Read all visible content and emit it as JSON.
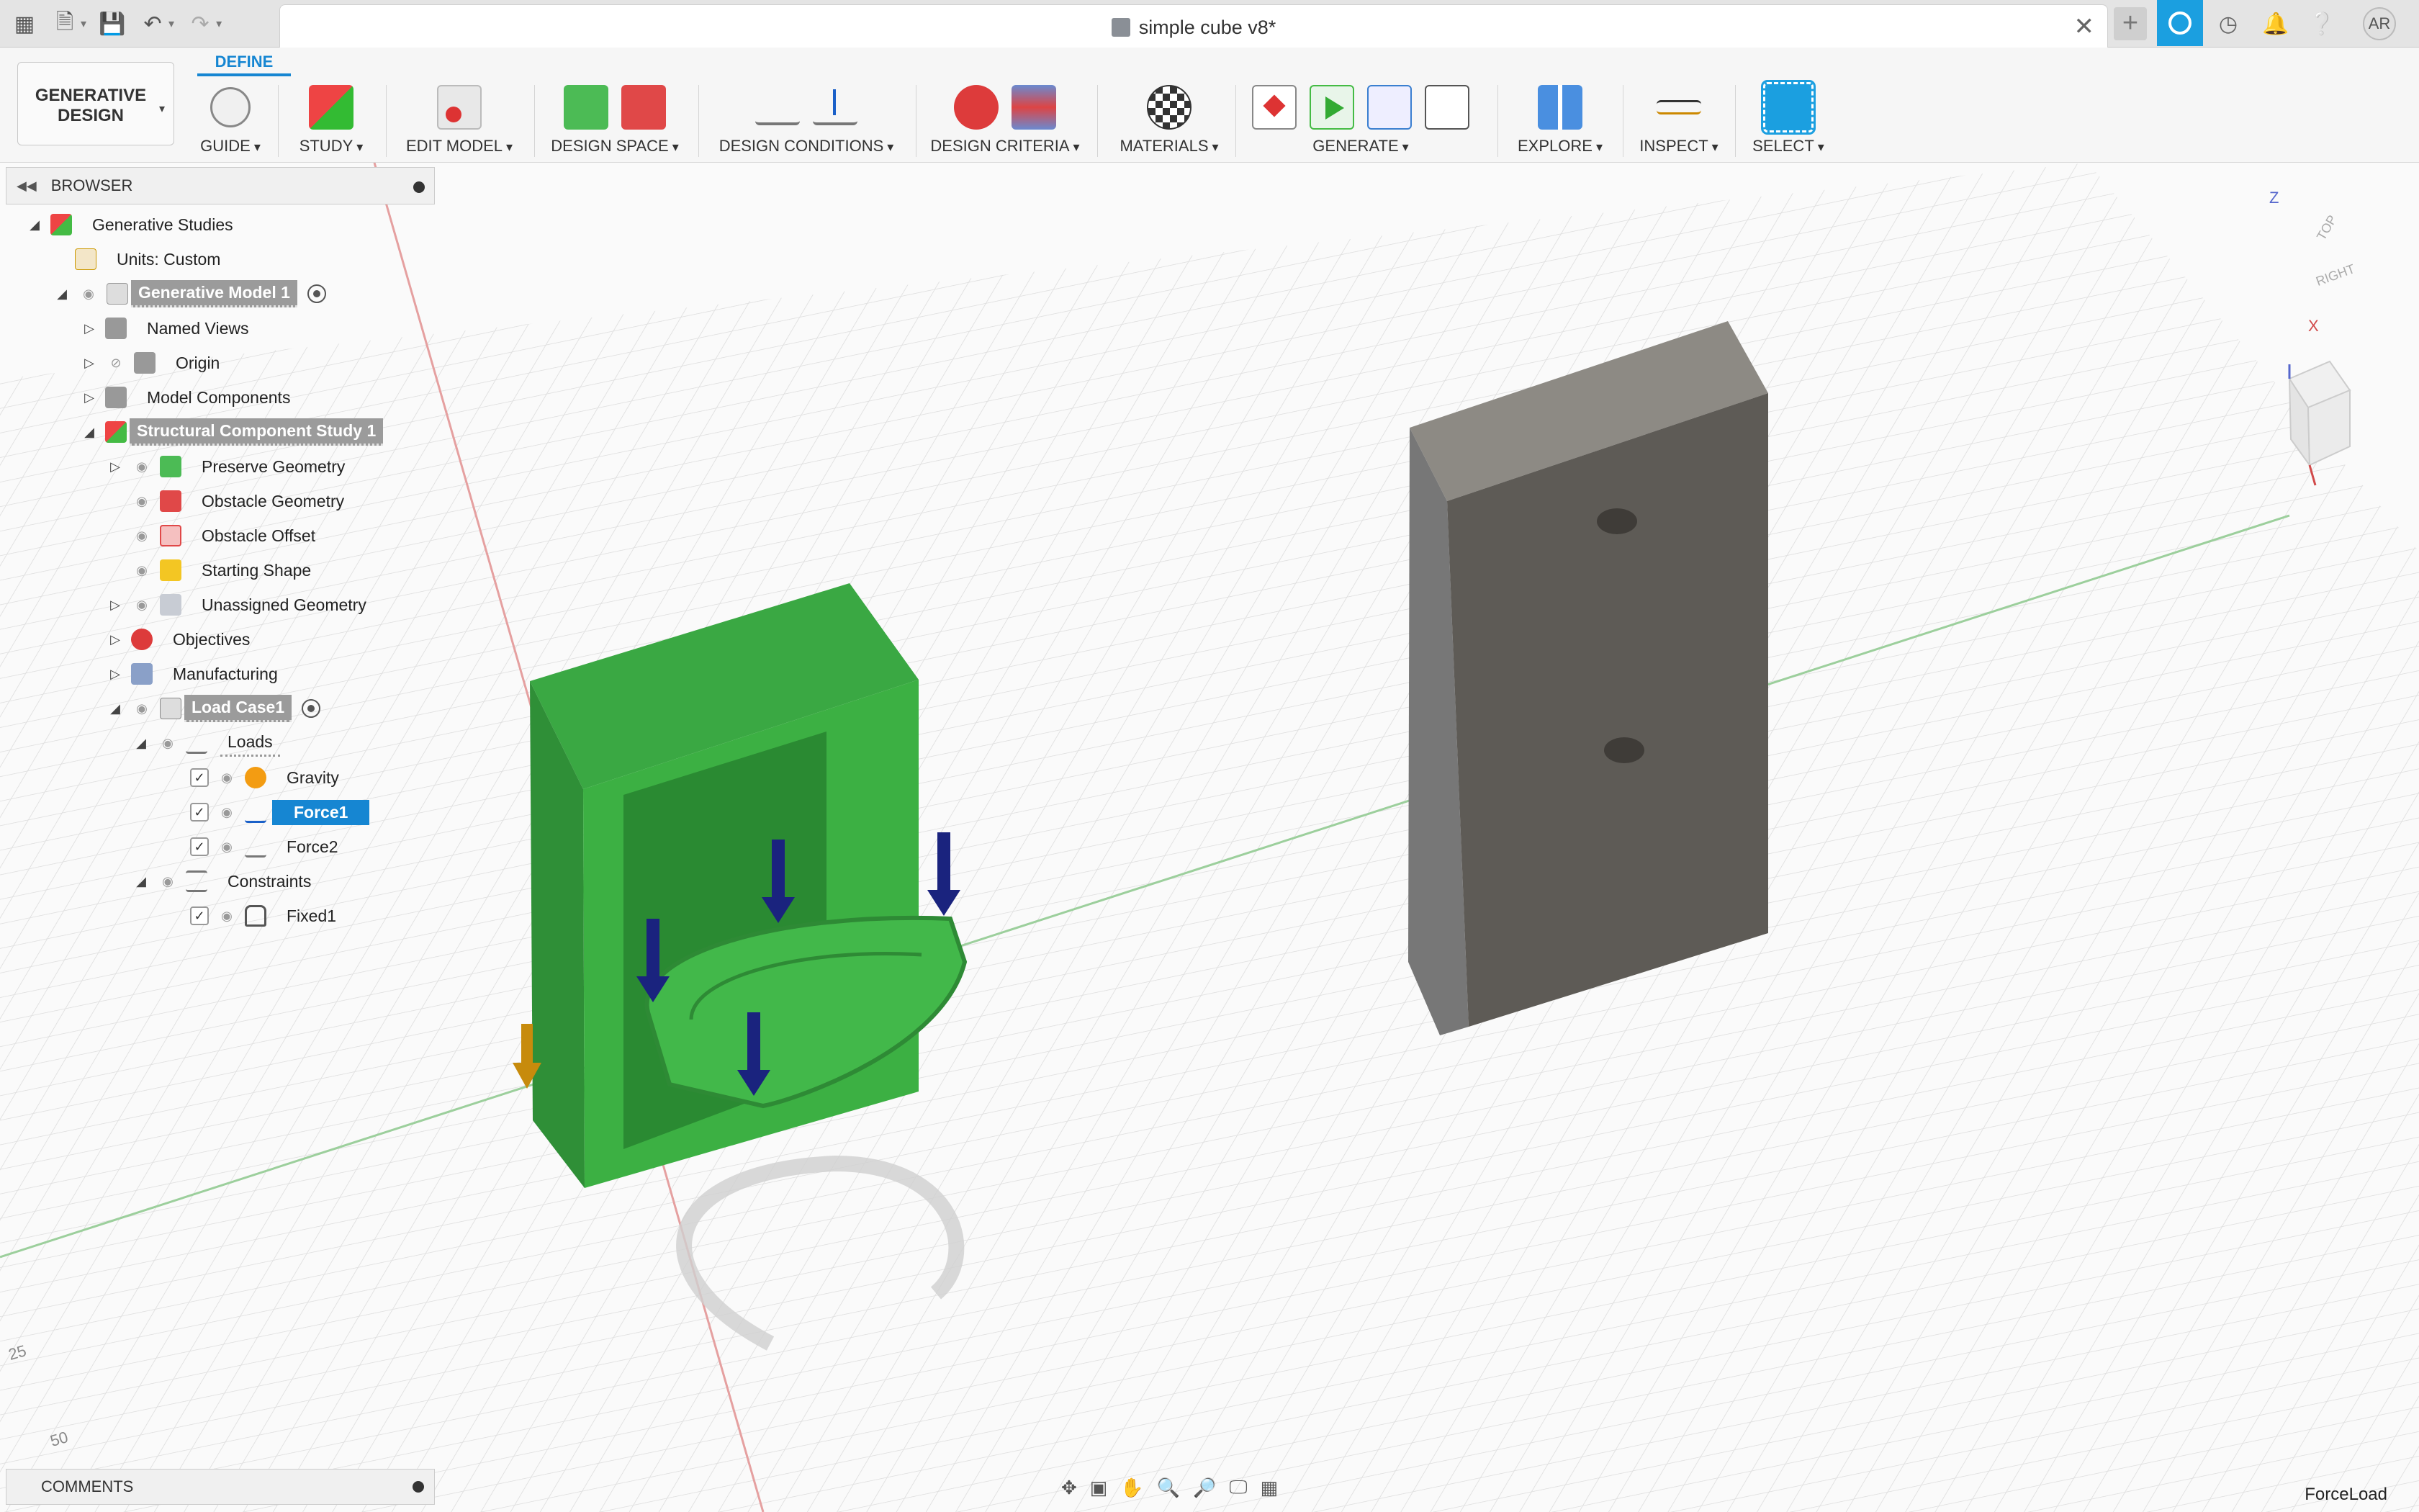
{
  "titlebar": {
    "document_title": "simple cube v8*",
    "avatar_initials": "AR",
    "icons": [
      "apps-grid-icon",
      "file-icon",
      "save-icon",
      "undo-icon",
      "redo-icon",
      "close-icon",
      "new-tab-icon",
      "extension-icon",
      "job-status-icon",
      "notifications-icon",
      "help-icon"
    ]
  },
  "toolbar": {
    "workspace_label": "GENERATIVE DESIGN",
    "active_tab": "DEFINE",
    "groups": [
      {
        "label": "GUIDE"
      },
      {
        "label": "STUDY"
      },
      {
        "label": "EDIT MODEL"
      },
      {
        "label": "DESIGN SPACE"
      },
      {
        "label": "DESIGN CONDITIONS"
      },
      {
        "label": "DESIGN CRITERIA"
      },
      {
        "label": "MATERIALS"
      },
      {
        "label": "GENERATE"
      },
      {
        "label": "EXPLORE"
      },
      {
        "label": "INSPECT"
      },
      {
        "label": "SELECT"
      }
    ]
  },
  "browser": {
    "title": "BROWSER",
    "items": [
      {
        "label": "Generative Studies"
      },
      {
        "label": "Units: Custom"
      },
      {
        "label": "Generative Model 1"
      },
      {
        "label": "Named Views"
      },
      {
        "label": "Origin"
      },
      {
        "label": "Model Components"
      },
      {
        "label": "Structural Component Study 1"
      },
      {
        "label": "Preserve Geometry"
      },
      {
        "label": "Obstacle Geometry"
      },
      {
        "label": "Obstacle Offset"
      },
      {
        "label": "Starting Shape"
      },
      {
        "label": "Unassigned Geometry"
      },
      {
        "label": "Objectives"
      },
      {
        "label": "Manufacturing"
      },
      {
        "label": "Load Case1"
      },
      {
        "label": "Loads"
      },
      {
        "label": "Gravity"
      },
      {
        "label": "Force1"
      },
      {
        "label": "Force2"
      },
      {
        "label": "Constraints"
      },
      {
        "label": "Fixed1"
      }
    ]
  },
  "comments": {
    "title": "COMMENTS"
  },
  "viewport": {
    "viewcube_top": "TOP",
    "viewcube_right": "RIGHT",
    "axis_z": "Z",
    "axis_x": "X",
    "ruler_25": "25",
    "ruler_50": "50",
    "status_text": "ForceLoad"
  },
  "colors": {
    "accent": "#1686d2",
    "preserve_green": "#3cb043",
    "load_arrow": "#1a237e",
    "obstacle_body": "#6b6760"
  }
}
